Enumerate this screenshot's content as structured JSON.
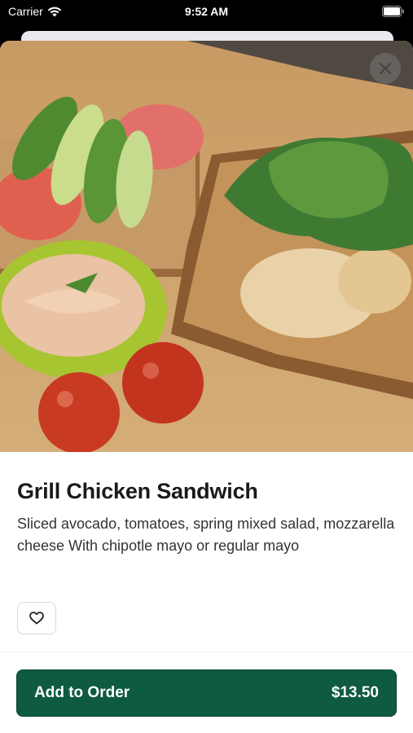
{
  "status_bar": {
    "carrier": "Carrier",
    "time": "9:52 AM"
  },
  "product": {
    "title": "Grill Chicken Sandwich",
    "description": "Sliced avocado, tomatoes, spring mixed salad, mozzarella cheese  With chipotle mayo or regular mayo"
  },
  "actions": {
    "add_label": "Add to Order",
    "price": "$13.50"
  },
  "icons": {
    "close": "close-icon",
    "favorite": "heart-icon",
    "wifi": "wifi-icon",
    "battery": "battery-icon"
  },
  "colors": {
    "primary": "#0e5a43",
    "text": "#1a1a1a"
  }
}
